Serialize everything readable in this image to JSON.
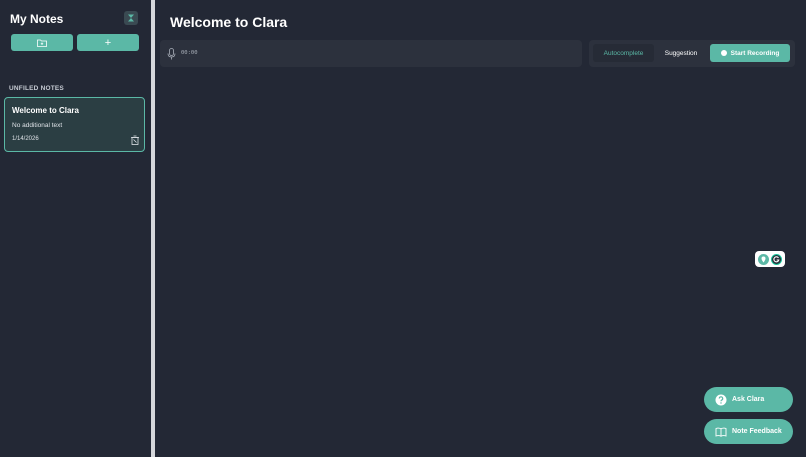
{
  "sidebar": {
    "title": "My Notes",
    "new_folder_icon": "folder-plus-icon",
    "add_icon": "plus-icon",
    "add_label": "+",
    "pin_icon": "hourglass-icon",
    "section_label": "UNFILED NOTES",
    "notes": [
      {
        "title": "Welcome to Clara",
        "subtitle": "No additional text",
        "date": "1/14/2026"
      }
    ]
  },
  "main": {
    "title": "Welcome to Clara",
    "timer": "00:00",
    "tabs": [
      {
        "label": "Autocomplete",
        "active": true
      },
      {
        "label": "Suggestion",
        "active": false
      }
    ],
    "start_recording_label": "Start Recording"
  },
  "floating": {
    "ask_label": "Ask Clara",
    "feedback_label": "Note Feedback"
  },
  "colors": {
    "background": "#232835",
    "accent": "#5bb8a6",
    "panel": "#2c313d"
  }
}
